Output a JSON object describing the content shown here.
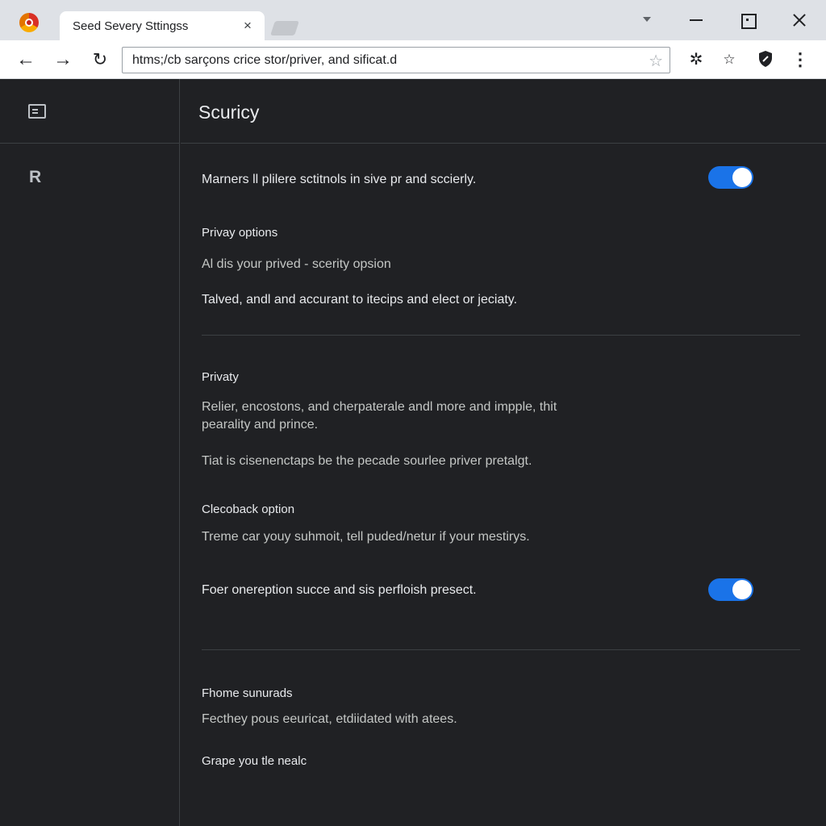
{
  "browser": {
    "tab_title": "Seed Severy Sttingss",
    "tab_close": "×",
    "url": "htms;/cb sarçons crice stor/priver, and sificat.d"
  },
  "icons": {
    "app": "browser-logo-icon",
    "back": "arrow-left-icon",
    "forward": "arrow-right-icon",
    "reload": "reload-icon",
    "bookmark_star": "star-outline-icon",
    "extensions": "puzzle-icon",
    "profile_shield": "shield-icon",
    "menu": "kebab-menu-icon",
    "panel": "side-panel-icon"
  },
  "toolbar": {
    "back_glyph": "←",
    "forward_glyph": "→",
    "reload_glyph": "↻",
    "star_glyph": "☆",
    "ext_glyph": "✲",
    "bookmark_glyph": "☆",
    "menu_glyph": "⋮"
  },
  "rail": {
    "letter": "R"
  },
  "main": {
    "title": "Scuricy",
    "rows": {
      "toggle1_label": "Marners ll plilere sctitnols in sive pr and sccierly.",
      "privay_options": "Privay options",
      "line1": "Al dis your prived - scerity opsion",
      "line2": "Talved, andl and accurant to itecips and elect or jeciaty.",
      "privaty": "Privaty",
      "para": "Relier, encostons, and cherpaterale andl more and impple, thit pearality and prince.",
      "line3": "Tiat is cisenenctaps be the pecade sourlee priver pretalgt.",
      "clecoback": "Clecoback option",
      "line4": "Treme car youy suhmoit, tell puded/netur if your mestirys.",
      "toggle2_label": "Foer onereption succe and sis perfloish presect.",
      "fhome": "Fhome sunurads",
      "line5": "Fecthey pous eeuricat, etdiidated with atees.",
      "grape": "Grape you tle nealc"
    },
    "toggles": {
      "first_on": true,
      "second_on": true
    }
  },
  "colors": {
    "accent": "#1a73e8",
    "page_bg": "#202124",
    "text": "#e8eaed"
  }
}
